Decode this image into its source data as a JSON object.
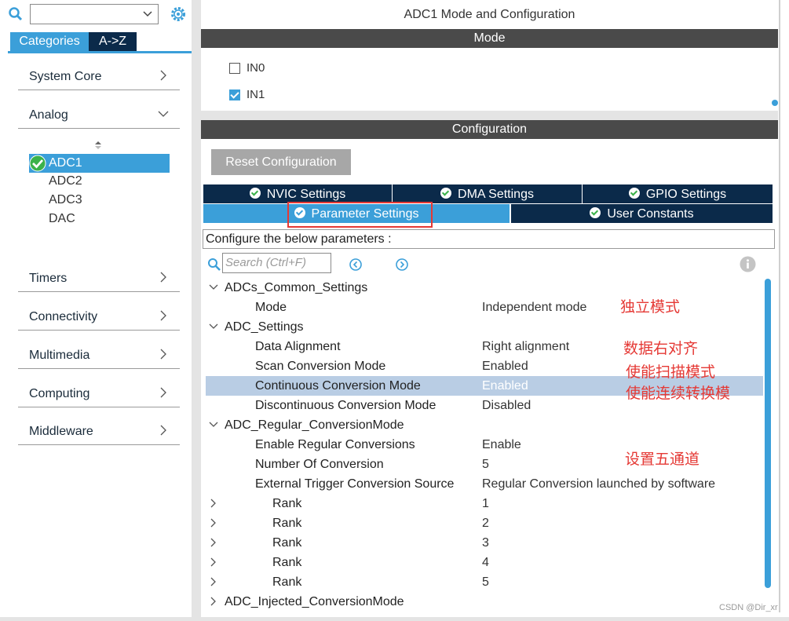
{
  "left": {
    "search": {
      "placeholder": ""
    },
    "tabs": {
      "categories": "Categories",
      "az": "A->Z"
    },
    "categories": [
      {
        "label": "System Core"
      },
      {
        "label": "Analog"
      },
      {
        "label": "Timers"
      },
      {
        "label": "Connectivity"
      },
      {
        "label": "Multimedia"
      },
      {
        "label": "Computing"
      },
      {
        "label": "Middleware"
      }
    ],
    "analog_items": [
      {
        "label": "ADC1",
        "selected": true
      },
      {
        "label": "ADC2"
      },
      {
        "label": "ADC3"
      },
      {
        "label": "DAC"
      }
    ]
  },
  "main": {
    "title": "ADC1 Mode and Configuration",
    "mode_header": "Mode",
    "mode_items": [
      {
        "label": "IN0",
        "checked": false
      },
      {
        "label": "IN1",
        "checked": true
      }
    ],
    "config_header": "Configuration",
    "reset_button": "Reset Configuration",
    "tabs_row1": [
      "NVIC Settings",
      "DMA Settings",
      "GPIO Settings"
    ],
    "tabs_row2": [
      "Parameter Settings",
      "User Constants"
    ],
    "description": "Configure the below parameters :",
    "search_placeholder": "Search (Ctrl+F)",
    "params": [
      {
        "name": "ADCs_Common_Settings",
        "value": ""
      },
      {
        "name": "Mode",
        "value": "Independent mode"
      },
      {
        "name": "ADC_Settings",
        "value": ""
      },
      {
        "name": "Data Alignment",
        "value": "Right alignment"
      },
      {
        "name": "Scan Conversion Mode",
        "value": "Enabled"
      },
      {
        "name": "Continuous Conversion Mode",
        "value": "Enabled"
      },
      {
        "name": "Discontinuous Conversion Mode",
        "value": "Disabled"
      },
      {
        "name": "ADC_Regular_ConversionMode",
        "value": ""
      },
      {
        "name": "Enable Regular Conversions",
        "value": "Enable"
      },
      {
        "name": "Number Of Conversion",
        "value": "5"
      },
      {
        "name": "External Trigger Conversion Source",
        "value": "Regular Conversion launched by software"
      },
      {
        "name": "Rank",
        "value": "1"
      },
      {
        "name": "Rank",
        "value": "2"
      },
      {
        "name": "Rank",
        "value": "3"
      },
      {
        "name": "Rank",
        "value": "4"
      },
      {
        "name": "Rank",
        "value": "5"
      },
      {
        "name": "ADC_Injected_ConversionMode",
        "value": ""
      }
    ]
  },
  "annotations": [
    "独立模式",
    "数据右对齐",
    "使能扫描模式",
    "使能连续转换模",
    "设置五通道"
  ],
  "watermark": "CSDN @Dir_xr",
  "colors": {
    "accent": "#3b9fd9",
    "navy": "#0b2a4a",
    "header": "#4a4a4a",
    "annotation": "#e53935",
    "selected_row": "#b9cde4"
  }
}
